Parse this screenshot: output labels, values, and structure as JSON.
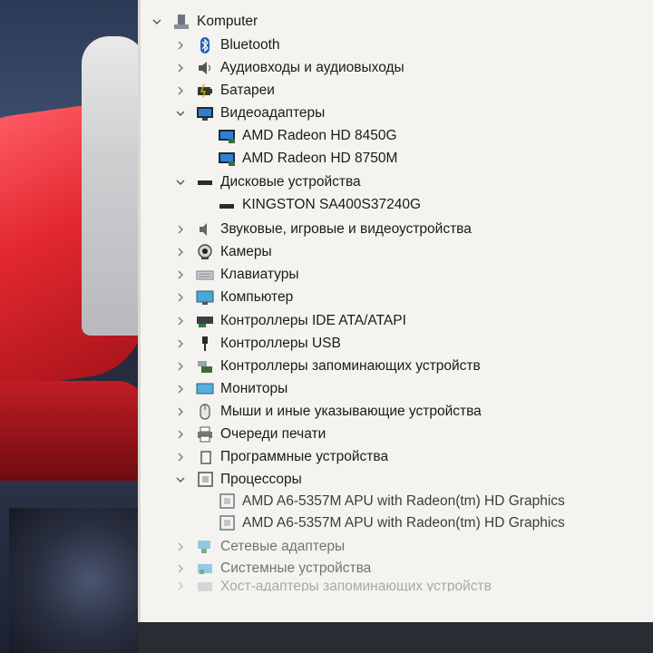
{
  "tree": {
    "root": {
      "label": "Komputer",
      "expanded": true
    },
    "nodes": [
      {
        "label": "Bluetooth",
        "icon": "bluetooth-icon",
        "expanded": false
      },
      {
        "label": "Аудиовходы и аудиовыходы",
        "icon": "speaker-icon",
        "expanded": false
      },
      {
        "label": "Батареи",
        "icon": "battery-icon",
        "expanded": false
      },
      {
        "label": "Видеоадаптеры",
        "icon": "display-adapter-icon",
        "expanded": true,
        "children": [
          {
            "label": "AMD Radeon HD 8450G",
            "icon": "display-adapter-icon"
          },
          {
            "label": "AMD Radeon HD 8750M",
            "icon": "display-adapter-icon"
          }
        ]
      },
      {
        "label": "Дисковые устройства",
        "icon": "disk-drive-icon",
        "expanded": true,
        "children": [
          {
            "label": "KINGSTON SA400S37240G",
            "icon": "disk-drive-icon"
          }
        ]
      },
      {
        "label": "Звуковые, игровые и видеоустройства",
        "icon": "sound-icon",
        "expanded": false
      },
      {
        "label": "Камеры",
        "icon": "camera-icon",
        "expanded": false
      },
      {
        "label": "Клавиатуры",
        "icon": "keyboard-icon",
        "expanded": false
      },
      {
        "label": "Компьютер",
        "icon": "computer-icon",
        "expanded": false
      },
      {
        "label": "Контроллеры IDE ATA/ATAPI",
        "icon": "ide-controller-icon",
        "expanded": false
      },
      {
        "label": "Контроллеры USB",
        "icon": "usb-icon",
        "expanded": false
      },
      {
        "label": "Контроллеры запоминающих устройств",
        "icon": "storage-controller-icon",
        "expanded": false
      },
      {
        "label": "Мониторы",
        "icon": "monitor-icon",
        "expanded": false
      },
      {
        "label": "Мыши и иные указывающие устройства",
        "icon": "mouse-icon",
        "expanded": false
      },
      {
        "label": "Очереди печати",
        "icon": "printer-icon",
        "expanded": false
      },
      {
        "label": "Программные устройства",
        "icon": "software-device-icon",
        "expanded": false
      },
      {
        "label": "Процессоры",
        "icon": "processor-icon",
        "expanded": true,
        "children": [
          {
            "label": "AMD A6-5357M APU with Radeon(tm) HD Graphics",
            "icon": "processor-icon"
          },
          {
            "label": "AMD A6-5357M APU with Radeon(tm) HD Graphics",
            "icon": "processor-icon"
          }
        ]
      },
      {
        "label": "Сетевые адаптеры",
        "icon": "network-adapter-icon",
        "expanded": false
      },
      {
        "label": "Системные устройства",
        "icon": "system-device-icon",
        "expanded": false
      },
      {
        "label": "Хост-адаптеры запоминающих устройств",
        "icon": "storage-host-icon",
        "expanded": false
      }
    ]
  },
  "colors": {
    "panel_bg": "#f4f3ef",
    "text": "#1b1b1b",
    "chevron": "#7a7a7a",
    "monitor_blue": "#2f7fd6"
  }
}
